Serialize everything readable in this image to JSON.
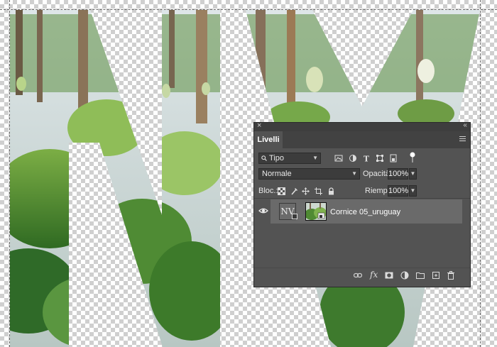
{
  "panel": {
    "tab_label": "Livelli",
    "close_glyph": "×",
    "collapse_glyph": "‹‹",
    "filter": {
      "search_glyph": "🔍",
      "label": "Tipo"
    },
    "filter_icons": [
      "image-filter-icon",
      "adjustment-filter-icon",
      "type-filter-icon",
      "shape-filter-icon",
      "smart-object-filter-icon",
      "filter-toggle-icon"
    ],
    "blend_mode": "Normale",
    "opacity_label": "Opacità:",
    "opacity_value": "100%",
    "lock_label": "Bloc.:",
    "lock_icons": [
      "lock-transparency-icon",
      "lock-image-icon",
      "lock-position-icon",
      "lock-artboard-icon",
      "lock-all-icon"
    ],
    "fill_label": "Riemp.:",
    "fill_value": "100%",
    "layers": [
      {
        "name": "Cornice 05_uruguay",
        "visible": true,
        "type_thumb_text": "NV"
      }
    ],
    "bottom_icons": [
      "link-layers-icon",
      "layer-style-icon",
      "add-mask-icon",
      "new-adjustment-icon",
      "new-group-icon",
      "new-layer-icon",
      "delete-layer-icon"
    ],
    "fx_label": "fx"
  },
  "colors": {
    "panel_bg": "#535353",
    "selected_row": "#6a6a6a",
    "field_bg": "#3c3c3c"
  }
}
